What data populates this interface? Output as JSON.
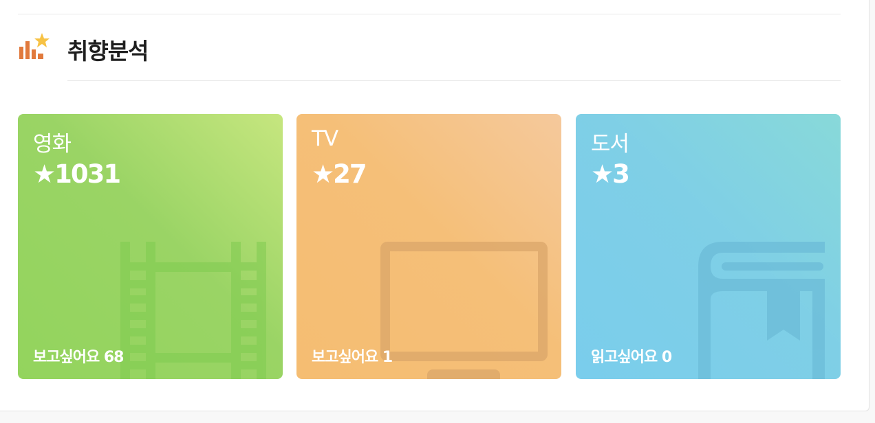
{
  "section": {
    "title": "취향분석",
    "icon": "bar-chart-star-icon"
  },
  "cards": [
    {
      "category": "영화",
      "rating_display": "★1031",
      "wish_label": "보고싶어요",
      "wish_count": "68",
      "icon": "film-strip-icon",
      "color_top": "#c6e67f",
      "color_bottom": "#93d45d"
    },
    {
      "category": "TV",
      "rating_display": "★27",
      "wish_label": "보고싶어요",
      "wish_count": "1",
      "icon": "tv-icon",
      "color_top": "#f5c99c",
      "color_bottom": "#f5bd72"
    },
    {
      "category": "도서",
      "rating_display": "★3",
      "wish_label": "읽고싶어요",
      "wish_count": "0",
      "icon": "book-icon",
      "color_top": "#88d9d9",
      "color_bottom": "#7acdec"
    }
  ]
}
